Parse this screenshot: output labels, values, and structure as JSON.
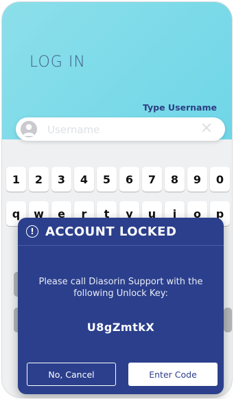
{
  "login": {
    "title": "LOG IN",
    "username_label": "Type Username",
    "username_placeholder": "Username",
    "username_value": "",
    "clear_glyph": "✕"
  },
  "keyboard": {
    "number_row": [
      "1",
      "2",
      "3",
      "4",
      "5",
      "6",
      "7",
      "8",
      "9",
      "0"
    ],
    "letter_row": [
      "q",
      "w",
      "e",
      "r",
      "t",
      "y",
      "u",
      "i",
      "o",
      "p"
    ]
  },
  "dialog": {
    "icon_glyph": "!",
    "title": "ACCOUNT LOCKED",
    "message": "Please call Diasorin Support with the following Unlock Key:",
    "unlock_key": "U8gZmtkX",
    "cancel_label": "No, Cancel",
    "enter_label": "Enter Code"
  },
  "colors": {
    "hero_gradient_start": "#8cdfea",
    "hero_gradient_end": "#6fd6e7",
    "dialog_background": "#2b3f8c",
    "label_color": "#2d3f84"
  },
  "icons": {
    "avatar": "user-avatar-icon",
    "clear": "close-icon",
    "alert": "alert-circle-icon"
  }
}
